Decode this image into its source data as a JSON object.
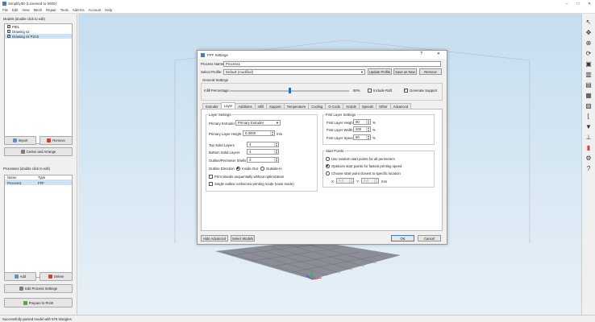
{
  "window": {
    "title": "Simplify3D (Licensed to 0000)",
    "minimize": "–",
    "maximize": "□",
    "close": "✕"
  },
  "menu": [
    "File",
    "Edit",
    "View",
    "Mesh",
    "Repair",
    "Tools",
    "Add-Ins",
    "Account",
    "Help"
  ],
  "models": {
    "label": "Models (double click to edit)",
    "items": [
      {
        "name": "PIEL",
        "checked": true,
        "selected": false
      },
      {
        "name": "Drawing v2",
        "checked": true,
        "selected": false
      },
      {
        "name": "Drawing v2 P2A2",
        "checked": true,
        "selected": true
      }
    ],
    "import_label": "Import",
    "remove_label": "Remove",
    "center_label": "Center and Arrange"
  },
  "processes": {
    "label": "Processes (double click to edit)",
    "col_name": "Name",
    "col_type": "Type",
    "rows": [
      {
        "name": "Process1",
        "type": "FFF"
      }
    ],
    "add_label": "Add",
    "delete_label": "Delete",
    "edit_label": "Edit Process Settings",
    "prepare_label": "Prepare to Print!"
  },
  "status": "Successfully parsed model with 576 triangles",
  "toolbar_icons": [
    "select-icon",
    "move-icon",
    "zoom-icon",
    "rotate-icon",
    "view-iso-icon",
    "view-front-icon",
    "view-side-icon",
    "view-top-icon",
    "view-bottom-icon",
    "cross-section-icon",
    "nozzle-icon",
    "support-icon",
    "preview-icon",
    "settings-icon",
    "help-icon"
  ],
  "dialog": {
    "title": "FFF Settings",
    "help_glyph": "?",
    "close_glyph": "✕",
    "process_name_label": "Process Name:",
    "process_name": "Process1",
    "select_profile_label": "Select Profile:",
    "profile": "Default (modified)",
    "update_profile": "Update Profile",
    "save_as_new": "Save as New",
    "remove": "Remove",
    "general_settings": "General Settings",
    "infill_label": "Infill Percentage:",
    "infill_value": "50%",
    "infill_fraction": 0.5,
    "include_raft": "Include Raft",
    "include_raft_checked": false,
    "generate_support": "Generate Support",
    "generate_support_checked": true,
    "tabs": [
      "Extruder",
      "Layer",
      "Additions",
      "Infill",
      "Support",
      "Temperature",
      "Cooling",
      "G-Code",
      "Scripts",
      "Speeds",
      "Other",
      "Advanced"
    ],
    "active_tab": "Layer",
    "layer_settings": {
      "label": "Layer Settings",
      "primary_extruder_label": "Primary Extruder",
      "primary_extruder": "Primary Extruder",
      "primary_layer_height_label": "Primary Layer Height",
      "primary_layer_height": "0.3000",
      "mm": "mm",
      "top_solid_label": "Top Solid Layers",
      "top_solid": "4",
      "bottom_solid_label": "Bottom Solid Layers",
      "bottom_solid": "4",
      "outline_shells_label": "Outline/Perimeter Shells",
      "outline_shells": "3",
      "outline_direction_label": "Outline Direction",
      "inside_out": "Inside-Out",
      "outside_in": "Outside-In",
      "print_islands": "Print islands sequentially without optimization",
      "single_outline": "Single outline corkscrew printing mode (vase mode)"
    },
    "first_layer": {
      "label": "First Layer Settings",
      "height_label": "First Layer Height",
      "height": "90",
      "width_label": "First Layer Width",
      "width": "200",
      "speed_label": "First Layer Speed",
      "speed": "50",
      "pct": "%"
    },
    "start_points": {
      "label": "Start Points",
      "opt1": "Use random start points for all perimeters",
      "opt2": "Optimize start points for fastest printing speed",
      "opt3": "Choose start point closest to specific location",
      "x_label": "X:",
      "x": "0.0",
      "y_label": "Y:",
      "y": "0.0",
      "mm": "mm"
    },
    "hide_advanced": "Hide Advanced",
    "select_models": "Select Models",
    "ok": "OK",
    "cancel": "Cancel"
  }
}
